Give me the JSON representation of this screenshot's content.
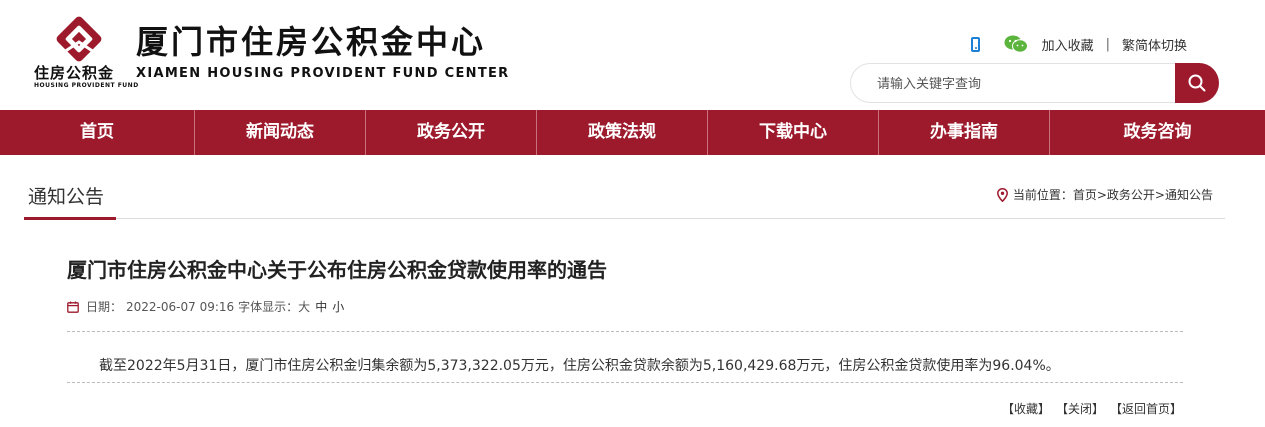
{
  "header": {
    "logo_cn": "住房公积金",
    "logo_en": "HOUSING PROVIDENT FUND",
    "org_name_cn": "厦门市住房公积金中心",
    "org_name_en": "XIAMEN HOUSING PROVIDENT FUND CENTER",
    "icons": [
      "phone-icon",
      "wechat-icon"
    ],
    "links": {
      "favorite": "加入收藏",
      "separator": "|",
      "switch_script": "繁简体切换"
    },
    "search": {
      "placeholder": "请输入关键字查询",
      "value": ""
    }
  },
  "nav": {
    "items": [
      {
        "label": "首页"
      },
      {
        "label": "新闻动态"
      },
      {
        "label": "政务公开"
      },
      {
        "label": "政策法规"
      },
      {
        "label": "下载中心"
      },
      {
        "label": "办事指南"
      },
      {
        "label": "政务咨询"
      }
    ]
  },
  "section": {
    "title": "通知公告",
    "breadcrumb": {
      "prefix": "当前位置：",
      "home": "首页",
      "sep": ">",
      "level1": "政务公开",
      "level2": "通知公告"
    }
  },
  "article": {
    "title": "厦门市住房公积金中心关于公布住房公积金贷款使用率的通告",
    "date_label": "日期：",
    "date": "2022-06-07 09:16",
    "font_label": "字体显示：",
    "font_sizes": [
      "大",
      "中",
      "小"
    ],
    "body": "截至2022年5月31日，厦门市住房公积金归集余额为5,373,322.05万元，住房公积金贷款余额为5,160,429.68万元，住房公积金贷款使用率为96.04%。"
  },
  "footer_links": {
    "favorite": "【收藏】",
    "close": "【关闭】",
    "home": "【返回首页】"
  },
  "colors": {
    "brand_red": "#9c1a2c",
    "phone_blue": "#1e7fd6",
    "wechat_green": "#5bb53c"
  }
}
